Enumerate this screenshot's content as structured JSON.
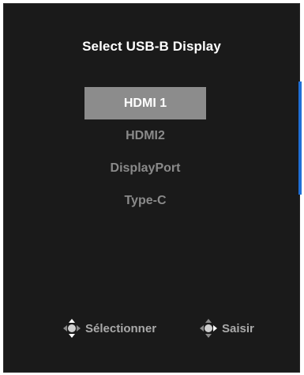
{
  "osd": {
    "title": "Select USB-B Display",
    "options": [
      {
        "label": "HDMI 1",
        "selected": true
      },
      {
        "label": "HDMI2",
        "selected": false
      },
      {
        "label": "DisplayPort",
        "selected": false
      },
      {
        "label": "Type-C",
        "selected": false
      }
    ],
    "hints": {
      "select_label": "Sélectionner",
      "select_icon": "joystick-updown-icon",
      "enter_label": "Saisir",
      "enter_icon": "joystick-right-icon"
    },
    "colors": {
      "panel_bg": "#1a1a1a",
      "selected_bg": "#8c8c8c",
      "scrollbar": "#1f6fd6",
      "dim_text": "#8a8a8a"
    }
  }
}
